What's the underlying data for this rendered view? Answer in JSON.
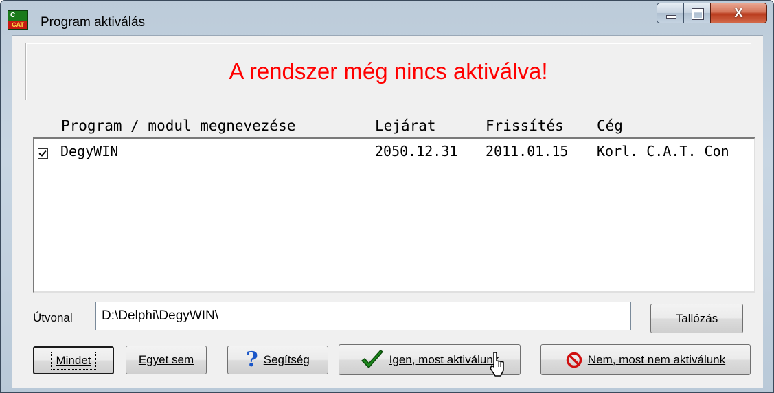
{
  "window": {
    "title": "Program aktiválás",
    "app_icon_top": "C",
    "app_icon_bottom": "CAT",
    "close_glyph": "X"
  },
  "banner": {
    "text": "A rendszer még nincs aktiválva!",
    "color": "#ff0000"
  },
  "list": {
    "headers": {
      "name": "Program / modul megnevezése",
      "expiry": "Lejárat",
      "update": "Frissítés",
      "company": "Cég"
    },
    "rows": [
      {
        "checked": true,
        "name": "DegyWIN",
        "expiry": "2050.12.31",
        "update": "2011.01.15",
        "company": "Korl. C.A.T. Con"
      }
    ]
  },
  "path": {
    "label": "Útvonal",
    "value": "D:\\Delphi\\DegyWIN\\"
  },
  "buttons": {
    "browse": "Tallózás",
    "all": "Mindet",
    "none": "Egyet sem",
    "help": "Segítség",
    "activate": "Igen, most aktiválunk",
    "cancel": "Nem, most nem aktiválunk"
  },
  "icons": {
    "help": "question-icon",
    "activate": "checkmark-icon",
    "cancel": "no-entry-icon",
    "pointer": "mouse-cursor-icon"
  }
}
